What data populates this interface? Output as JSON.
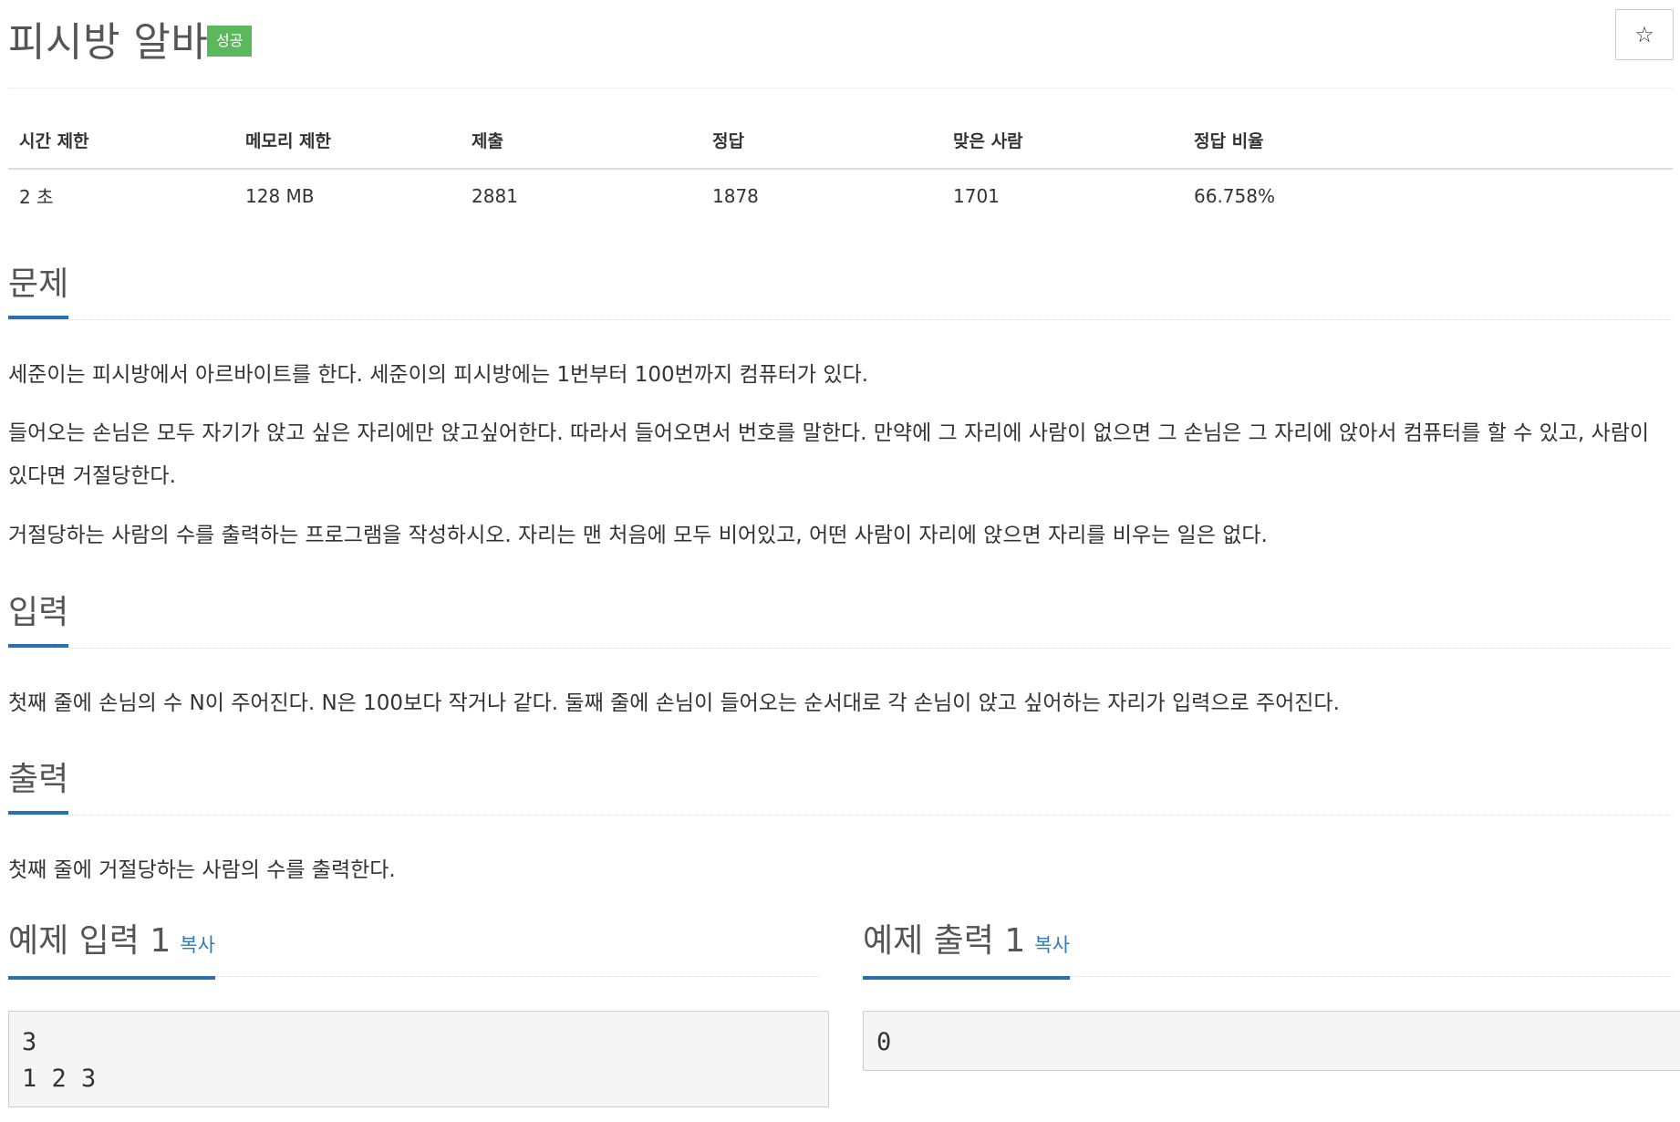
{
  "problem": {
    "title": "피시방 알바",
    "badge": "성공",
    "star_icon": "☆"
  },
  "info_table": {
    "headers": [
      "시간 제한",
      "메모리 제한",
      "제출",
      "정답",
      "맞은 사람",
      "정답 비율"
    ],
    "values": [
      "2 초",
      "128 MB",
      "2881",
      "1878",
      "1701",
      "66.758%"
    ]
  },
  "sections": {
    "problem": {
      "heading": "문제",
      "paragraphs": [
        "세준이는 피시방에서 아르바이트를 한다. 세준이의 피시방에는 1번부터 100번까지 컴퓨터가 있다.",
        "들어오는 손님은 모두 자기가 앉고 싶은 자리에만 앉고싶어한다. 따라서 들어오면서 번호를 말한다. 만약에 그 자리에 사람이 없으면 그 손님은 그 자리에 앉아서 컴퓨터를 할 수 있고, 사람이 있다면 거절당한다.",
        "거절당하는 사람의 수를 출력하는 프로그램을 작성하시오. 자리는 맨 처음에 모두 비어있고, 어떤 사람이 자리에 앉으면 자리를 비우는 일은 없다."
      ]
    },
    "input": {
      "heading": "입력",
      "paragraphs": [
        "첫째 줄에 손님의 수 N이 주어진다. N은 100보다 작거나 같다. 둘째 줄에 손님이 들어오는 순서대로 각 손님이 앉고 싶어하는 자리가 입력으로 주어진다."
      ]
    },
    "output": {
      "heading": "출력",
      "paragraphs": [
        "첫째 줄에 거절당하는 사람의 수를 출력한다."
      ]
    }
  },
  "examples": {
    "input": {
      "heading": "예제 입력 1",
      "copy_label": "복사",
      "content": "3\n1 2 3"
    },
    "output": {
      "heading": "예제 출력 1",
      "copy_label": "복사",
      "content": "0"
    }
  }
}
